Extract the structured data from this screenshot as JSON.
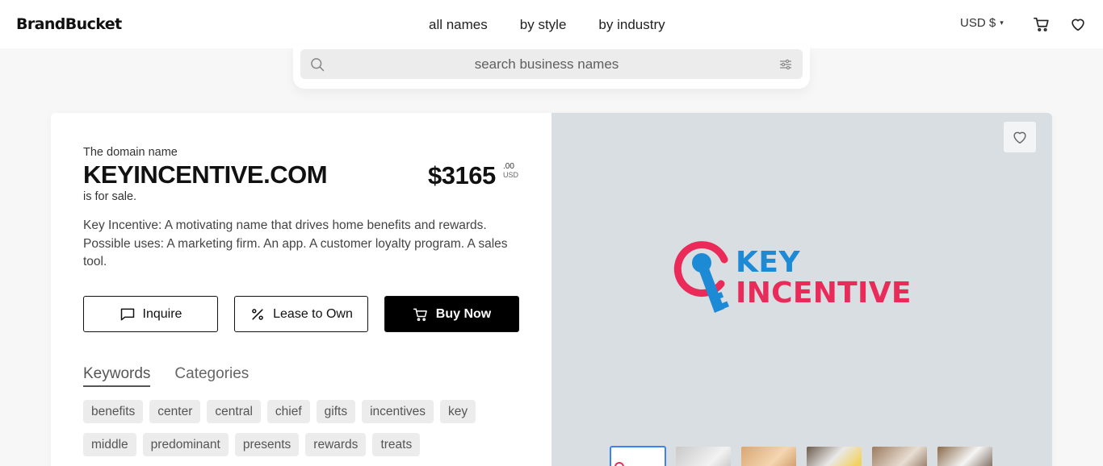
{
  "header": {
    "logo": "BrandBucket",
    "nav": [
      "all names",
      "by style",
      "by industry"
    ],
    "currency": "USD $"
  },
  "search": {
    "placeholder": "search business names"
  },
  "listing": {
    "intro": "The domain name",
    "domain": "KEYINCENTIVE.COM",
    "for_sale": "is for sale.",
    "price": "$3165",
    "price_cents": ".00",
    "price_currency": "USD",
    "description": "Key Incentive: A motivating name that drives home benefits and rewards. Possible uses: A marketing firm. An app. A customer loyalty program. A sales tool.",
    "buttons": {
      "inquire": "Inquire",
      "lease": "Lease to Own",
      "buy": "Buy Now"
    },
    "tabs": [
      "Keywords",
      "Categories"
    ],
    "keywords": [
      "benefits",
      "center",
      "central",
      "chief",
      "gifts",
      "incentives",
      "key",
      "middle",
      "predominant",
      "presents",
      "rewards",
      "treats"
    ]
  },
  "preview": {
    "logo_line1": "KEY",
    "logo_line2": "INCENTIVE",
    "colors": {
      "blue": "#1d8ad6",
      "pink": "#ea2b5a",
      "background": "#d9dee3"
    }
  }
}
